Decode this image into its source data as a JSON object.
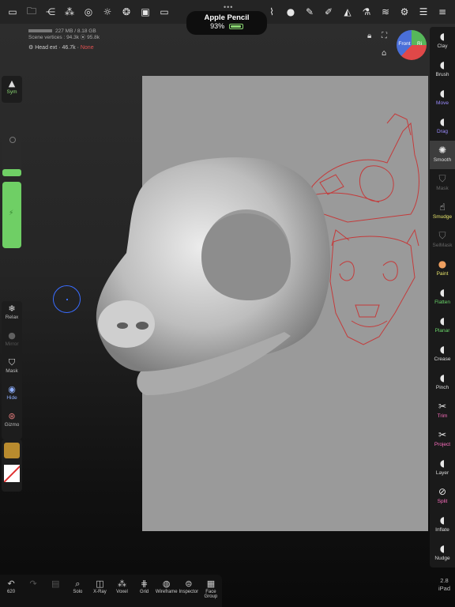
{
  "top_toolbar": {
    "icons": [
      "folder-icon",
      "share-icon",
      "layers-icon",
      "globe-icon",
      "sun-icon",
      "material-icon",
      "image-icon",
      "camera-icon",
      "scene-icon",
      "tool-settings-icon",
      "paintbrush-icon",
      "pen-icon",
      "triangle-icon",
      "flask-icon",
      "stack-icon",
      "gear-icon",
      "sliders-icon",
      "menu-icon"
    ]
  },
  "pencil": {
    "name": "Apple Pencil",
    "battery": "93%",
    "battery_level": 0.93
  },
  "stats": {
    "memory": "227 MB / 8.18 GB",
    "vertices_label": "Scene vertices :",
    "vertices_value": "94.3k",
    "vertices_total": "95.8k",
    "object_label": "Head ext",
    "object_count": "46.7k",
    "object_status": "None"
  },
  "gizmo": {
    "front": "Front",
    "right": "Ri"
  },
  "left_panel": {
    "sym": "Sym",
    "relax": "Relax",
    "mirror": "Mirror",
    "mask": "Mask",
    "hide": "Hide",
    "gizmo": "Gizmo"
  },
  "right_tools": [
    {
      "label": "Clay",
      "icon": "clay-icon",
      "color": "#dddddd"
    },
    {
      "label": "Brush",
      "icon": "brush-icon",
      "color": "#dddddd"
    },
    {
      "label": "Move",
      "icon": "move-icon",
      "color": "#9b8cff"
    },
    {
      "label": "Drag",
      "icon": "drag-icon",
      "color": "#9b8cff"
    },
    {
      "label": "Smooth",
      "icon": "smooth-icon",
      "color": "#dddddd"
    },
    {
      "label": "Mask",
      "icon": "mask-icon",
      "color": "#666666"
    },
    {
      "label": "Smudge",
      "icon": "smudge-icon",
      "color": "#e6e36a"
    },
    {
      "label": "SelMask",
      "icon": "selmask-icon",
      "color": "#666666"
    },
    {
      "label": "Paint",
      "icon": "paint-icon",
      "color": "#e6e36a"
    },
    {
      "label": "Flatten",
      "icon": "flatten-icon",
      "color": "#6ad56a"
    },
    {
      "label": "Planar",
      "icon": "planar-icon",
      "color": "#6ad56a"
    },
    {
      "label": "Crease",
      "icon": "crease-icon",
      "color": "#dddddd"
    },
    {
      "label": "Pinch",
      "icon": "pinch-icon",
      "color": "#dddddd"
    },
    {
      "label": "Trim",
      "icon": "trim-icon",
      "color": "#ff6fc0"
    },
    {
      "label": "Project",
      "icon": "project-icon",
      "color": "#ff6fc0"
    },
    {
      "label": "Layer",
      "icon": "layer-icon",
      "color": "#dddddd"
    },
    {
      "label": "Split",
      "icon": "split-icon",
      "color": "#ff6fc0"
    },
    {
      "label": "Inflate",
      "icon": "inflate-icon",
      "color": "#dddddd"
    },
    {
      "label": "Nudge",
      "icon": "nudge-icon",
      "color": "#dddddd"
    }
  ],
  "bottom_bar": [
    {
      "label": "620",
      "icon": "undo-icon"
    },
    {
      "label": "",
      "icon": "redo-icon"
    },
    {
      "label": "",
      "icon": "history-icon"
    },
    {
      "label": "Solo",
      "icon": "solo-icon"
    },
    {
      "label": "X-Ray",
      "icon": "xray-icon"
    },
    {
      "label": "Voxel",
      "icon": "voxel-icon"
    },
    {
      "label": "Grid",
      "icon": "grid-icon"
    },
    {
      "label": "Wireframe",
      "icon": "wireframe-icon"
    },
    {
      "label": "Inspector",
      "icon": "inspector-icon"
    },
    {
      "label": "Face Group",
      "icon": "facegroup-icon"
    }
  ],
  "version": {
    "number": "2.8",
    "device": "iPad"
  }
}
